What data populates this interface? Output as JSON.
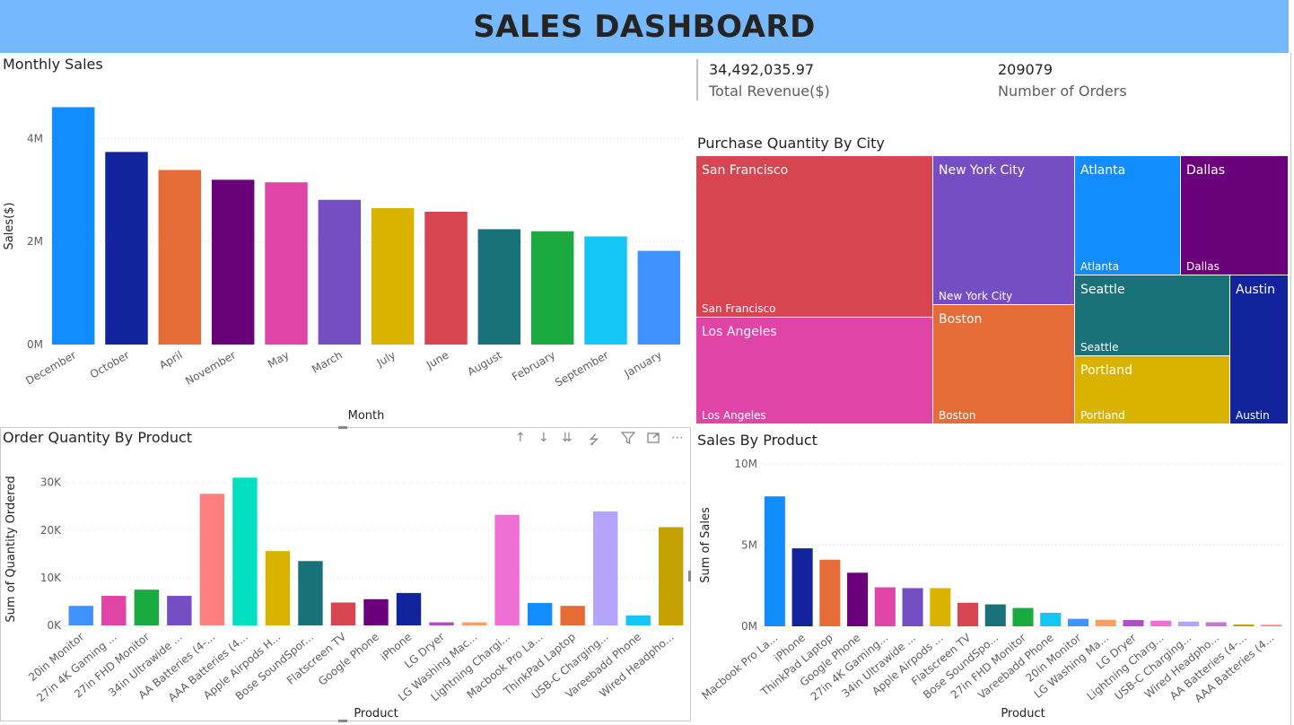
{
  "header": {
    "title": "SALES DASHBOARD"
  },
  "kpis": [
    {
      "value": "34,492,035.97",
      "label": "Total Revenue($)"
    },
    {
      "value": "209079",
      "label": "Number of Orders"
    }
  ],
  "charts": {
    "monthly": {
      "title": "Monthly Sales"
    },
    "city": {
      "title": "Purchase Quantity By City"
    },
    "order_qty": {
      "title": "Order Quantity By Product"
    },
    "sales_product": {
      "title": "Sales By Product"
    }
  },
  "toolbar": {
    "icons": [
      "arrow-up-icon",
      "arrow-down-icon",
      "double-arrow-down-icon",
      "expand-hierarchy-icon",
      "filter-icon",
      "focus-mode-icon",
      "more-options-icon"
    ]
  },
  "chart_data": [
    {
      "id": "monthly",
      "type": "bar",
      "title": "Monthly Sales",
      "xlabel": "Month",
      "ylabel": "Sales($)",
      "ylim": [
        0,
        4600000
      ],
      "yticks": [
        0,
        2000000,
        4000000
      ],
      "ytick_labels": [
        "0M",
        "2M",
        "4M"
      ],
      "grid": true,
      "categories": [
        "December",
        "October",
        "April",
        "November",
        "May",
        "March",
        "July",
        "June",
        "August",
        "February",
        "September",
        "January"
      ],
      "values": [
        4610000,
        3740000,
        3390000,
        3200000,
        3150000,
        2810000,
        2650000,
        2580000,
        2240000,
        2200000,
        2100000,
        1820000
      ],
      "colors": [
        "#118dff",
        "#12239e",
        "#e66c37",
        "#6b007b",
        "#e044a7",
        "#744ec2",
        "#d9b300",
        "#d64550",
        "#197278",
        "#1aab40",
        "#15c6f4",
        "#4092ff"
      ]
    },
    {
      "id": "city",
      "type": "treemap",
      "title": "Purchase Quantity By City",
      "categories": [
        "San Francisco",
        "Los Angeles",
        "New York City",
        "Boston",
        "Atlanta",
        "Dallas",
        "Seattle",
        "Portland",
        "Austin"
      ],
      "colors": [
        "#d64550",
        "#e044a7",
        "#744ec2",
        "#e66c37",
        "#118dff",
        "#6b007b",
        "#197278",
        "#d9b300",
        "#12239e"
      ]
    },
    {
      "id": "order_qty",
      "type": "bar",
      "title": "Order Quantity By Product",
      "xlabel": "Product",
      "ylabel": "Sum of Quantity Ordered",
      "ylim": [
        0,
        32000
      ],
      "yticks": [
        0,
        10000,
        20000,
        30000
      ],
      "ytick_labels": [
        "0K",
        "10K",
        "20K",
        "30K"
      ],
      "grid": true,
      "categories": [
        "20in Monitor",
        "27in 4K Gaming ...",
        "27in FHD Monitor",
        "34in Ultrawide ...",
        "AA Batteries (4-...",
        "AAA Batteries (4...",
        "Apple Airpods H...",
        "Bose SoundSpor...",
        "Flatscreen TV",
        "Google Phone",
        "iPhone",
        "LG Dryer",
        "LG Washing Mac...",
        "Lightning Chargi...",
        "Macbook Pro La...",
        "ThinkPad Laptop",
        "USB-C Charging...",
        "Vareebadd Phone",
        "Wired Headpho..."
      ],
      "values": [
        4100,
        6200,
        7500,
        6200,
        27600,
        31000,
        15600,
        13500,
        4800,
        5500,
        6800,
        650,
        650,
        23200,
        4700,
        4100,
        23900,
        2100,
        20600
      ],
      "colors": [
        "#4092ff",
        "#e044a7",
        "#1aab40",
        "#744ec2",
        "#ff7f7f",
        "#00dfc0",
        "#d9b300",
        "#197278",
        "#d64550",
        "#6b007b",
        "#12239e",
        "#b24cc8",
        "#ff9f5f",
        "#f06fd6",
        "#118dff",
        "#e66c37",
        "#b4a3ff",
        "#15c6f4",
        "#c4a000"
      ]
    },
    {
      "id": "sales_product",
      "type": "bar",
      "title": "Sales By Product",
      "xlabel": "Product",
      "ylabel": "Sum of Sales",
      "ylim": [
        0,
        10000000
      ],
      "yticks": [
        0,
        5000000,
        10000000
      ],
      "ytick_labels": [
        "0M",
        "5M",
        "10M"
      ],
      "grid": true,
      "categories": [
        "Macbook Pro La...",
        "iPhone",
        "ThinkPad Laptop",
        "Google Phone",
        "27in 4K Gaming...",
        "34in Ultrawide ...",
        "Apple Airpods ...",
        "Flatscreen TV",
        "Bose SoundSpo...",
        "27in FHD Monitor",
        "Vareebadd Phone",
        "20in Monitor",
        "LG Washing Ma...",
        "LG Dryer",
        "Lightning Charg...",
        "USB-C Charging...",
        "Wired Headpho...",
        "AA Batteries (4-...",
        "AAA Batteries (4..."
      ],
      "values": [
        8000000,
        4800000,
        4100000,
        3300000,
        2400000,
        2350000,
        2350000,
        1450000,
        1350000,
        1130000,
        830000,
        460000,
        400000,
        390000,
        350000,
        290000,
        250000,
        110000,
        90000
      ],
      "colors": [
        "#118dff",
        "#12239e",
        "#e66c37",
        "#6b007b",
        "#e044a7",
        "#744ec2",
        "#d9b300",
        "#d64550",
        "#197278",
        "#1aab40",
        "#15c6f4",
        "#4092ff",
        "#ff9f5f",
        "#b24cc8",
        "#f06fd6",
        "#b4a3ff",
        "#c875d6",
        "#c4a000",
        "#ff7f7f"
      ]
    }
  ]
}
